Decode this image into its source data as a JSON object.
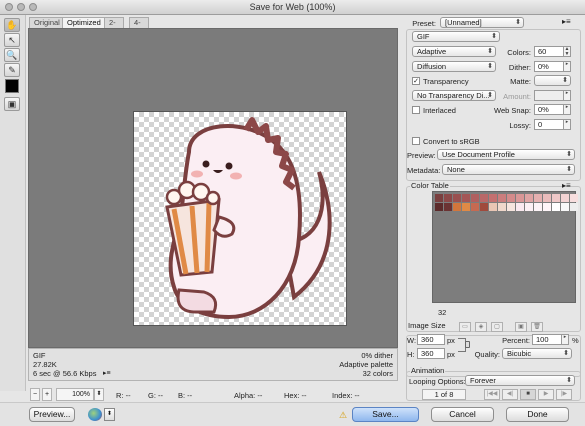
{
  "window": {
    "title": "Save for Web (100%)"
  },
  "tabs": [
    "Original",
    "Optimized",
    "2-Up",
    "4-Up"
  ],
  "active_tab": "Optimized",
  "info": {
    "format": "GIF",
    "size": "27.82K",
    "speed": "6 sec @ 56.6 Kbps",
    "dither": "0% dither",
    "palette": "Adaptive palette",
    "colors": "32 colors"
  },
  "statusbar": {
    "zoom": "100%",
    "r": "R: --",
    "g": "G: --",
    "b": "B: --",
    "alpha": "Alpha: --",
    "hex": "Hex: --",
    "index": "Index: --"
  },
  "buttons": {
    "preview": "Preview...",
    "save": "Save...",
    "cancel": "Cancel",
    "done": "Done"
  },
  "settings": {
    "preset_label": "Preset:",
    "preset_value": "[Unnamed]",
    "format": "GIF",
    "reduction": "Adaptive",
    "colors_label": "Colors:",
    "colors_value": "60",
    "dither_algo": "Diffusion",
    "dither_label": "Dither:",
    "dither_value": "0%",
    "transparency_label": "Transparency",
    "transparency_checked": true,
    "matte_label": "Matte:",
    "transparency_dither": "No Transparency Di...",
    "amount_label": "Amount:",
    "interlaced_label": "Interlaced",
    "websnap_label": "Web Snap:",
    "websnap_value": "0%",
    "lossy_label": "Lossy:",
    "lossy_value": "0",
    "convert_srgb_label": "Convert to sRGB",
    "preview_label": "Preview:",
    "preview_value": "Use Document Profile",
    "metadata_label": "Metadata:",
    "metadata_value": "None"
  },
  "color_table": {
    "title": "Color Table",
    "count": "32",
    "swatches": [
      "#7a3f3f",
      "#8c4848",
      "#9a5050",
      "#a45656",
      "#b06060",
      "#b96868",
      "#c47070",
      "#cb7d7d",
      "#d38a8a",
      "#d99696",
      "#dfa3a3",
      "#e5b0b0",
      "#eabcbc",
      "#efc8c8",
      "#f3d3d3",
      "#f7dede",
      "#5c2b2b",
      "#6b3333",
      "#d2763c",
      "#e08a46",
      "#c66a52",
      "#a04a3c",
      "#e9c6b4",
      "#f0d8cb",
      "#f6e5de",
      "#fae9ef",
      "#fcf0f4",
      "#fdf4f7",
      "#fff6f9",
      "#ffffff",
      "#f8f8f8",
      "#eeeeee"
    ]
  },
  "image_size": {
    "title": "Image Size",
    "w_label": "W:",
    "w_value": "360",
    "h_label": "H:",
    "h_value": "360",
    "unit": "px",
    "percent_label": "Percent:",
    "percent_value": "100",
    "percent_unit": "%",
    "quality_label": "Quality:",
    "quality_value": "Bicubic"
  },
  "animation": {
    "title": "Animation",
    "looping_label": "Looping Options:",
    "looping_value": "Forever",
    "frame": "1 of 8"
  },
  "colors": {
    "accent": "#5b84c4",
    "preview_bg": "#7b7b7b"
  }
}
